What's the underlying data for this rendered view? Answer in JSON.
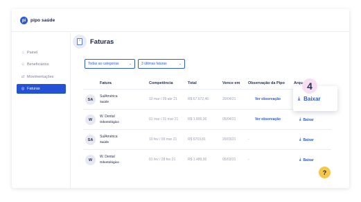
{
  "brand": {
    "name": "pipo saúde",
    "mark": "pi"
  },
  "sidebar": {
    "items": [
      {
        "label": "Painel",
        "icon": "home-icon"
      },
      {
        "label": "Beneficiários",
        "icon": "users-icon"
      },
      {
        "label": "Movimentações",
        "icon": "transfer-icon"
      },
      {
        "label": "Faturas",
        "icon": "invoice-icon",
        "active": true
      }
    ]
  },
  "page": {
    "title": "Faturas"
  },
  "filters": {
    "category": "Todas as categorias",
    "period": "3 últimas faturas"
  },
  "table": {
    "headers": {
      "fatura": "Fatura",
      "competencia": "Competência",
      "total": "Total",
      "vence": "Vence em",
      "obs": "Observação da Pipo",
      "arq": "Arqu"
    },
    "rows": [
      {
        "initials": "SA",
        "provider": "SulAmérica",
        "type": "Saúde",
        "competencia": "10 mar / 09 abr 21",
        "total": "R$ 67.672,46",
        "vence": "20/04/21",
        "obs": "Ver observação",
        "arquivo": ""
      },
      {
        "initials": "W",
        "provider": "W. Dental",
        "type": "Odontológico",
        "competencia": "01 mar / 31 mar 21",
        "total": "R$ 1.800,36",
        "vence": "05/04/21",
        "obs": "Ver observação",
        "arquivo": "Baixar"
      },
      {
        "initials": "SA",
        "provider": "SulAmérica",
        "type": "Saúde",
        "competencia": "10 fev / 09 mar 21",
        "total": "R$ 6703,81",
        "vence": "20/03/21",
        "obs": "-",
        "arquivo": "Baixar"
      },
      {
        "initials": "W",
        "provider": "W. Dental",
        "type": "Odontológico",
        "competencia": "01 fev / 28 fev 21",
        "total": "R$ 1.489,00",
        "vence": "05/03/21",
        "obs": "-",
        "arquivo": "Baixar"
      }
    ]
  },
  "popup": {
    "step": "4",
    "label": "Baixar",
    "icon": "download-icon"
  },
  "help": {
    "label": "?"
  },
  "colors": {
    "accent": "#2452d4",
    "badge": "#f7dff1",
    "help": "#f5c84c"
  }
}
